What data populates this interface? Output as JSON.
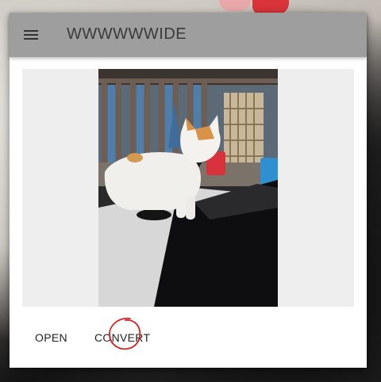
{
  "app": {
    "title": "WWWWWWIDE"
  },
  "toolbar": {
    "menu_icon": "hamburger-menu-icon"
  },
  "preview": {
    "image_subject": "white and orange cat on car roof"
  },
  "actions": {
    "open_label": "OPEN",
    "convert_label": "CONVERT"
  },
  "colors": {
    "toolbar_bg": "#9e9e9e",
    "card_bg": "#ffffff",
    "preview_bg": "#eeeeee",
    "annotation": "#d62020"
  }
}
